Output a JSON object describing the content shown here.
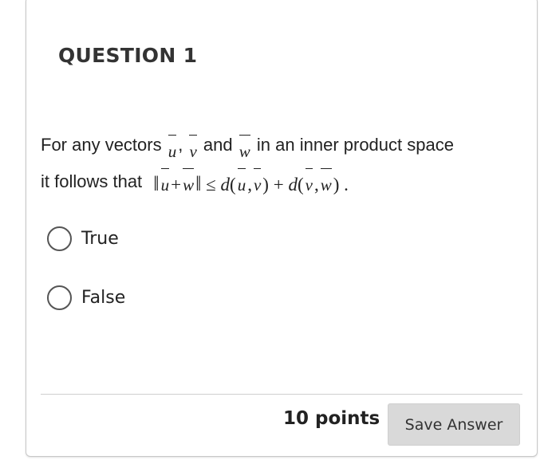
{
  "question": {
    "title": "QUESTION 1",
    "text_part1": "For any vectors",
    "vec_u": "u",
    "vec_v": "v",
    "text_and": "and",
    "vec_w": "w",
    "text_part2": "in an inner product space",
    "text_part3": "it follows that",
    "formula": {
      "lhs_norm_open": "‖",
      "u": "u",
      "plus": "+",
      "w": "w",
      "lhs_norm_close": "‖",
      "leq": "≤",
      "d1": "d",
      "d1_args_u": "u",
      "d1_args_v": "v",
      "plus2": "+",
      "d2": "d",
      "d2_args_v": "v",
      "d2_args_w": "w",
      "end": "."
    }
  },
  "options": [
    {
      "label": "True"
    },
    {
      "label": "False"
    }
  ],
  "footer": {
    "points": "10 points",
    "save_label": "Save Answer"
  }
}
